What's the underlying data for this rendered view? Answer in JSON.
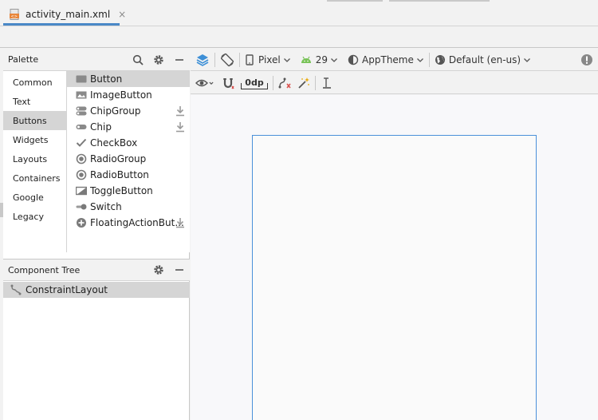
{
  "editor": {
    "tab": {
      "title": "activity_main.xml",
      "close": "×"
    }
  },
  "palette": {
    "title": "Palette",
    "icons": [
      "search-icon",
      "gear-icon",
      "minimize-icon"
    ],
    "categories": [
      "Common",
      "Text",
      "Buttons",
      "Widgets",
      "Layouts",
      "Containers",
      "Google",
      "Legacy"
    ],
    "selected_category": "Buttons",
    "widgets": [
      {
        "label": "Button",
        "icon": "button-icon",
        "selected": true,
        "download": false
      },
      {
        "label": "ImageButton",
        "icon": "image-icon",
        "selected": false,
        "download": false
      },
      {
        "label": "ChipGroup",
        "icon": "chipgroup-icon",
        "selected": false,
        "download": true
      },
      {
        "label": "Chip",
        "icon": "chip-icon",
        "selected": false,
        "download": true
      },
      {
        "label": "CheckBox",
        "icon": "checkmark-icon",
        "selected": false,
        "download": false
      },
      {
        "label": "RadioGroup",
        "icon": "radio-icon",
        "selected": false,
        "download": false
      },
      {
        "label": "RadioButton",
        "icon": "radio-icon",
        "selected": false,
        "download": false
      },
      {
        "label": "ToggleButton",
        "icon": "toggle-icon",
        "selected": false,
        "download": false
      },
      {
        "label": "Switch",
        "icon": "switch-icon",
        "selected": false,
        "download": false
      },
      {
        "label": "FloatingActionBut...",
        "icon": "plus-circle-icon",
        "selected": false,
        "download": true
      }
    ]
  },
  "component_tree": {
    "title": "Component Tree",
    "items": [
      "ConstraintLayout"
    ]
  },
  "toolbar": {
    "device": "Pixel",
    "api": "29",
    "theme": "AppTheme",
    "locale": "Default (en-us)",
    "margin": "0dp"
  },
  "colors": {
    "accent_blue": "#4a88c7",
    "android_green": "#78c257",
    "selection_gray": "#d5d5d5",
    "canvas_border": "#4a90d9"
  }
}
